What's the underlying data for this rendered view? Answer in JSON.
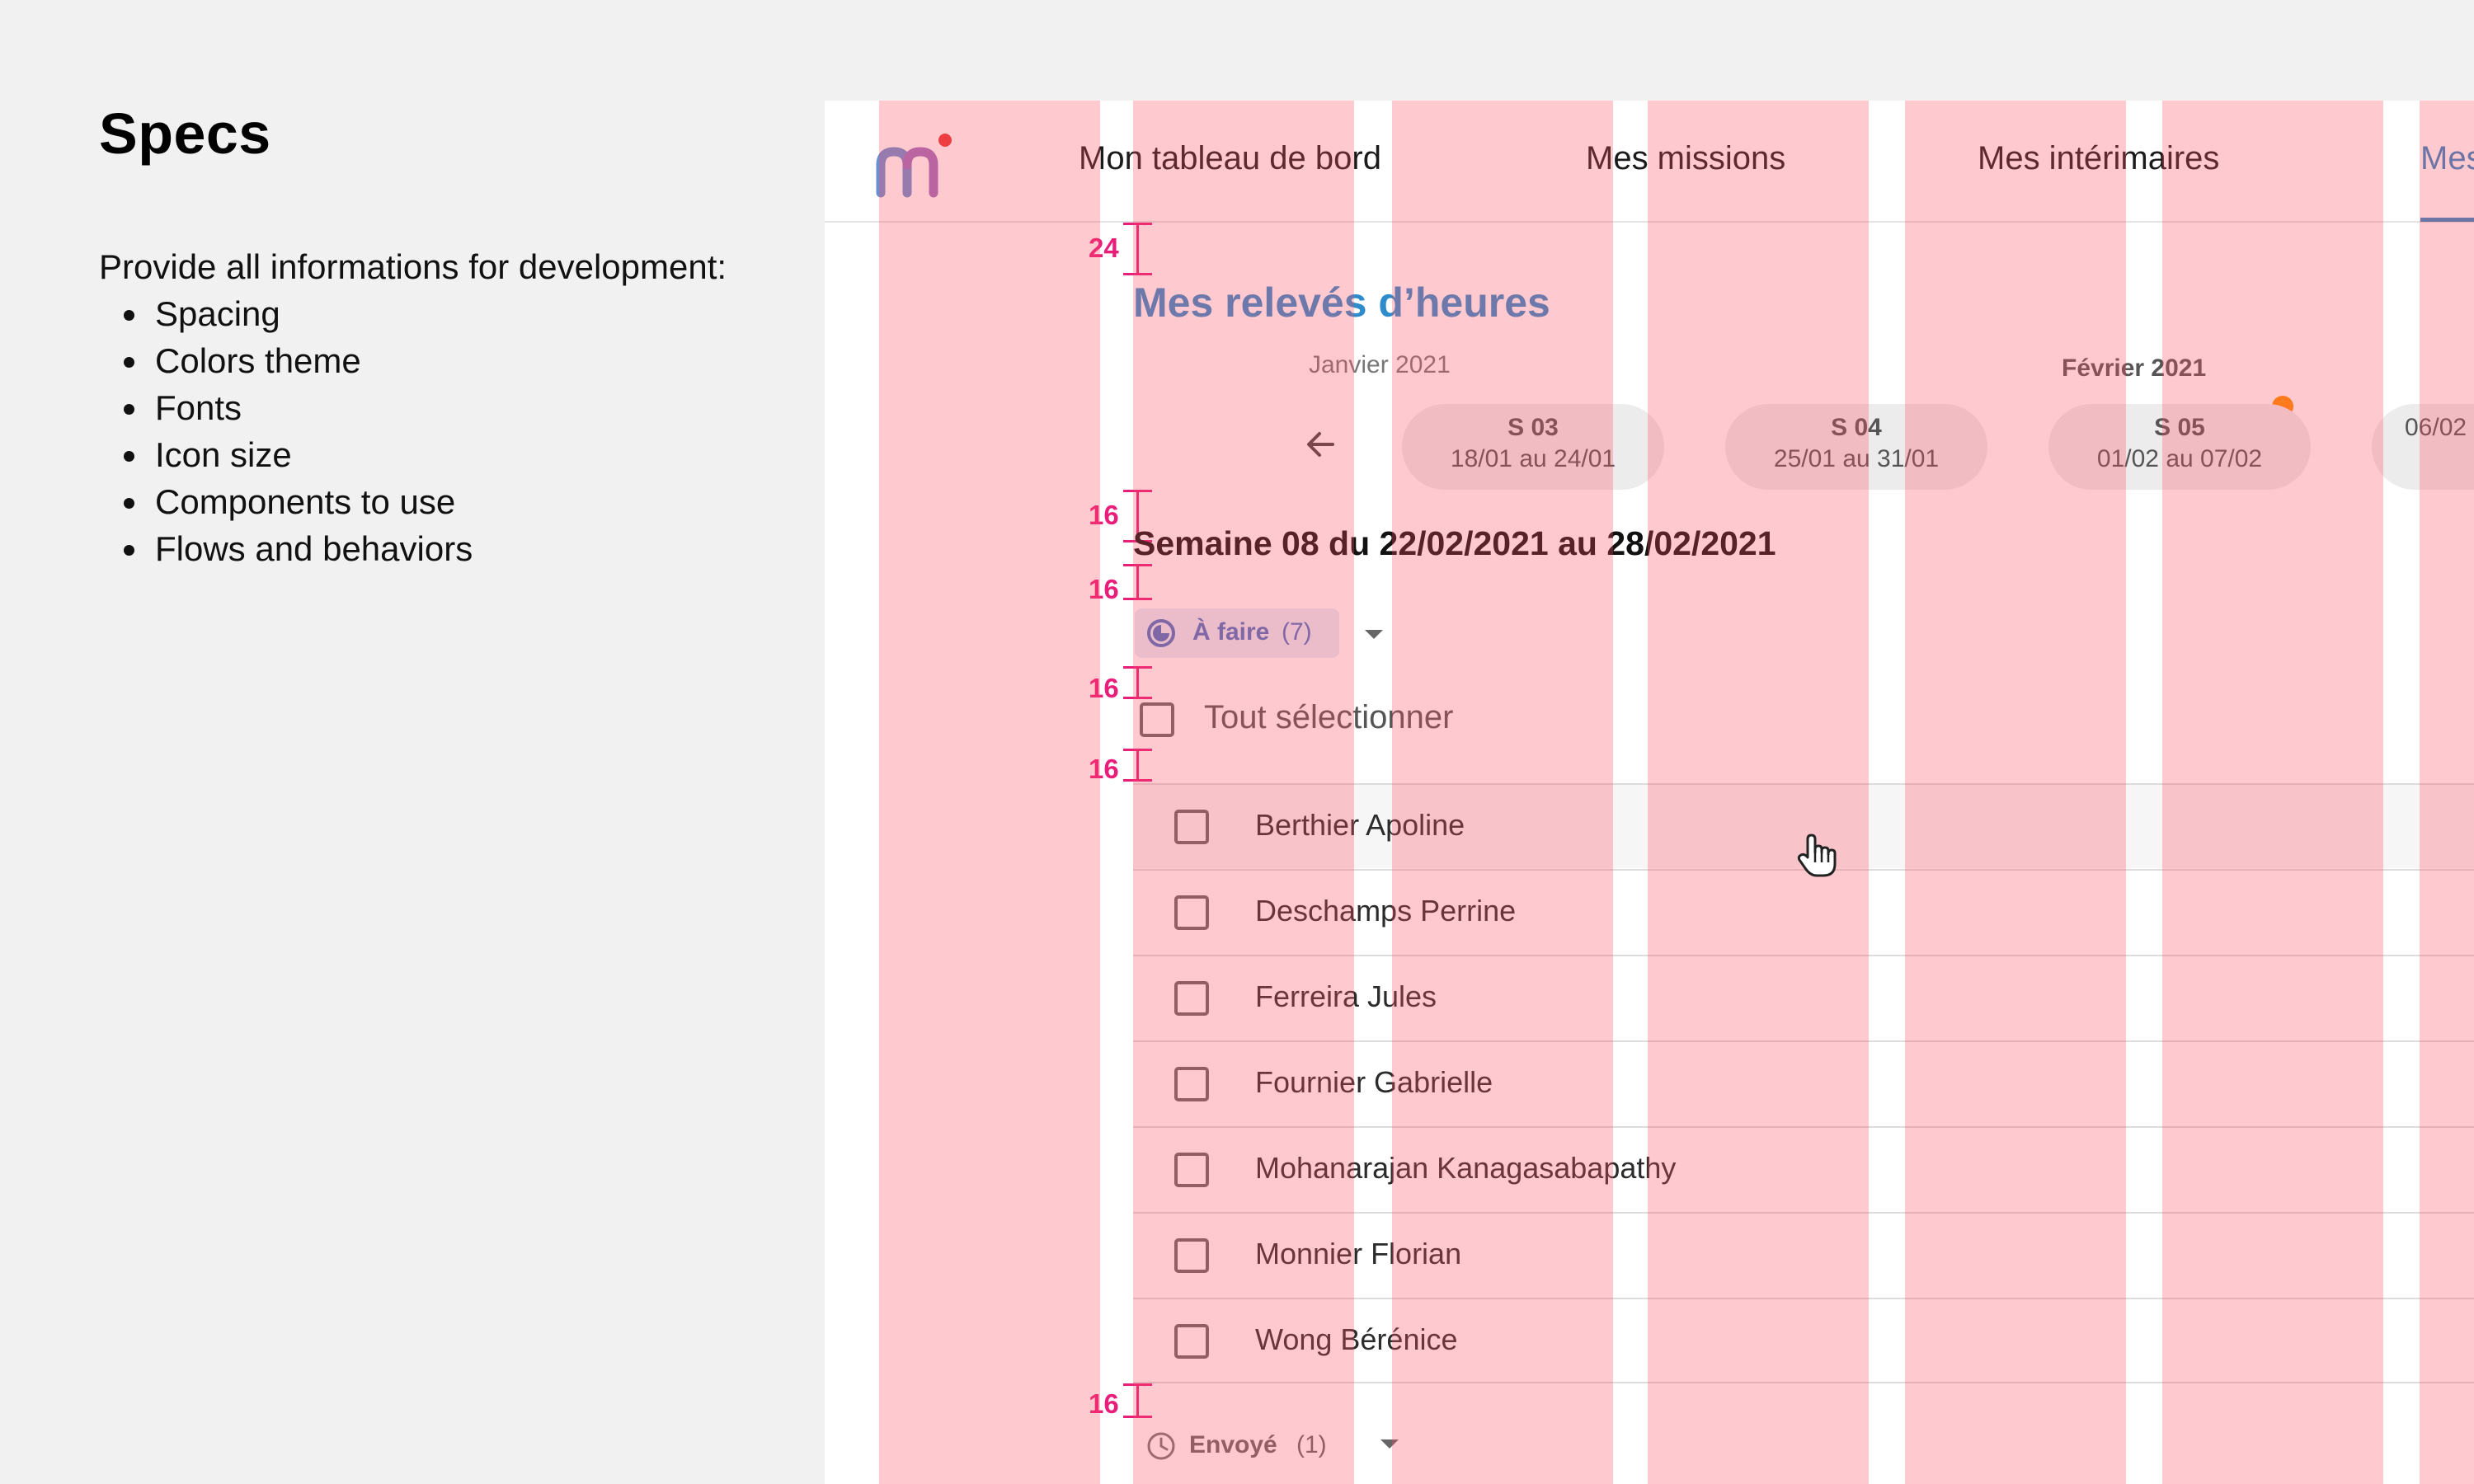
{
  "specs": {
    "title": "Specs",
    "intro": "Provide all informations for development:",
    "items": [
      "Spacing",
      "Colors theme",
      "Fonts",
      "Icon size",
      "Components to use",
      "Flows and behaviors"
    ]
  },
  "app": {
    "logo_icon": "m-logo-icon",
    "nav": {
      "items": [
        "Mon tableau de bord",
        "Mes missions",
        "Mes intérimaires",
        "Mes"
      ],
      "active_index": 3
    },
    "page_title": "Mes relevés d’heures",
    "calendar": {
      "months": [
        "Janvier 2021",
        "Février 2021"
      ],
      "weeks": [
        {
          "week": "S 03",
          "range": "18/01 au 24/01"
        },
        {
          "week": "S 04",
          "range": "25/01 au 31/01"
        },
        {
          "week": "S 05",
          "range": "01/02 au 07/02"
        },
        {
          "week": "",
          "range": "06/02"
        }
      ],
      "prev_icon": "arrow-left-icon"
    },
    "week_heading": "Semaine 08 du 22/02/2021 au 28/02/2021",
    "todo_status": {
      "label": "À faire",
      "count": "(7)",
      "icon": "half-moon-icon"
    },
    "select_all": "Tout sélectionner",
    "employees": [
      "Berthier Apoline",
      "Deschamps Perrine",
      "Ferreira Jules",
      "Fournier Gabrielle",
      "Mohanarajan Kanagasabapathy",
      "Monnier Florian",
      "Wong Bérénice"
    ],
    "sent_status": {
      "label": "Envoyé",
      "count": "(1)",
      "icon": "clock-icon"
    }
  },
  "annotations": {
    "spacing_values": [
      "24",
      "16",
      "16",
      "16",
      "16",
      "16"
    ],
    "spacing_color": "#e91e7a",
    "grid_overlay_color": "#ffc6c8"
  },
  "colors": {
    "primary": "#2f8ccc",
    "status_todo": "#4a73c6",
    "notification": "#ff8c00",
    "logo_dot": "#e53935"
  }
}
